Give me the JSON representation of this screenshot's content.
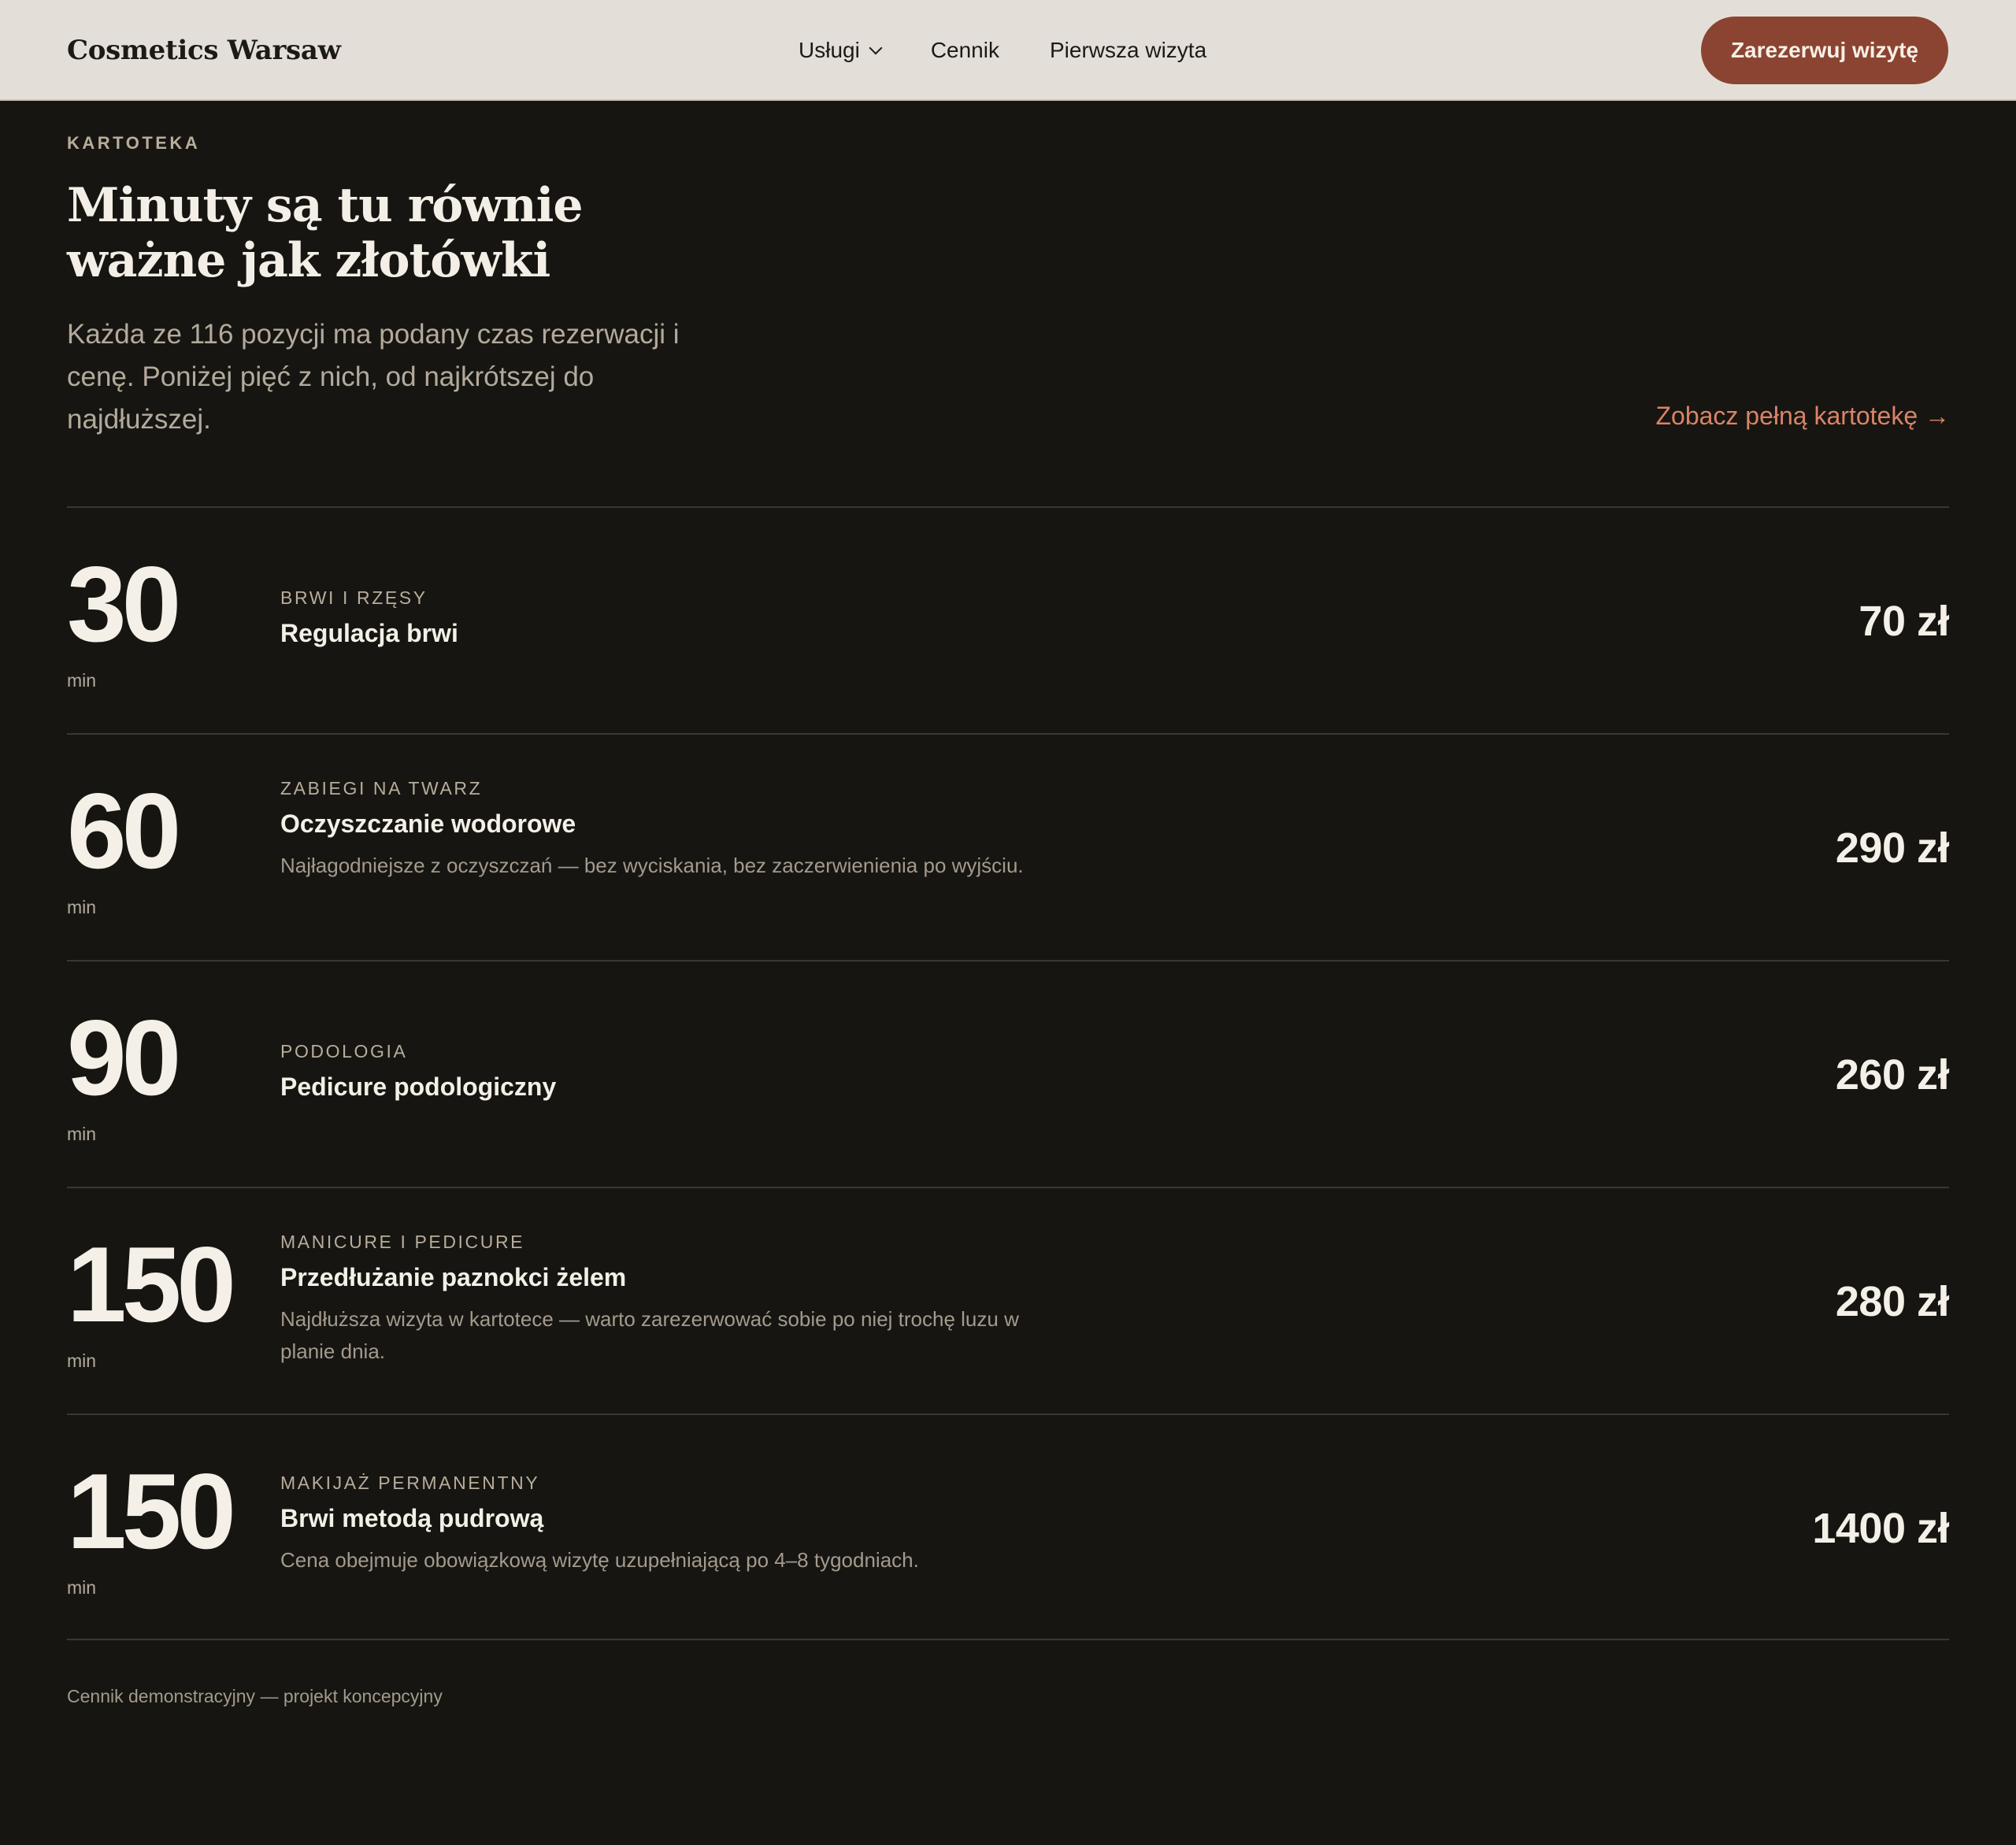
{
  "header": {
    "brand": "Cosmetics Warsaw",
    "nav": [
      {
        "label": "Usługi",
        "has_dropdown": true
      },
      {
        "label": "Cennik",
        "has_dropdown": false
      },
      {
        "label": "Pierwsza wizyta",
        "has_dropdown": false
      }
    ],
    "cta_label": "Zarezerwuj wizytę"
  },
  "intro": {
    "eyebrow": "KARTOTEKA",
    "headline_line1": "Minuty są tu równie",
    "headline_line2": "ważne jak złotówki",
    "lead": "Każda ze 116 pozycji ma podany czas rezerwacji i cenę. Poniżej pięć z nich, od najkrótszej do najdłuższej.",
    "link": "Zobacz pełną kartotekę →"
  },
  "items": [
    {
      "minutes": "30",
      "unit": "min",
      "category": "BRWI I RZĘSY",
      "name": "Regulacja brwi",
      "note": "",
      "price": "70 zł"
    },
    {
      "minutes": "60",
      "unit": "min",
      "category": "ZABIEGI NA TWARZ",
      "name": "Oczyszczanie wodorowe",
      "note": "Najłagodniejsze z oczyszczań — bez wyciskania, bez zaczerwienienia po wyjściu.",
      "price": "290 zł"
    },
    {
      "minutes": "90",
      "unit": "min",
      "category": "PODOLOGIA",
      "name": "Pedicure podologiczny",
      "note": "",
      "price": "260 zł"
    },
    {
      "minutes": "150",
      "unit": "min",
      "category": "MANICURE I PEDICURE",
      "name": "Przedłużanie paznokci żelem",
      "note": "Najdłuższa wizyta w kartotece — warto zarezerwować sobie po niej trochę luzu w planie dnia.",
      "price": "280 zł"
    },
    {
      "minutes": "150",
      "unit": "min",
      "category": "MAKIJAŻ PERMANENTNY",
      "name": "Brwi metodą pudrową",
      "note": "Cena obejmuje obowiązkową wizytę uzupełniającą po 4–8 tygodniach.",
      "price": "1400 zł"
    }
  ],
  "footnote": "Cennik demonstracyjny — projekt koncepcyjny",
  "colors": {
    "accent": "#8b4431",
    "link": "#d98467",
    "background": "#161511",
    "header_bg": "#e3dfd8"
  }
}
